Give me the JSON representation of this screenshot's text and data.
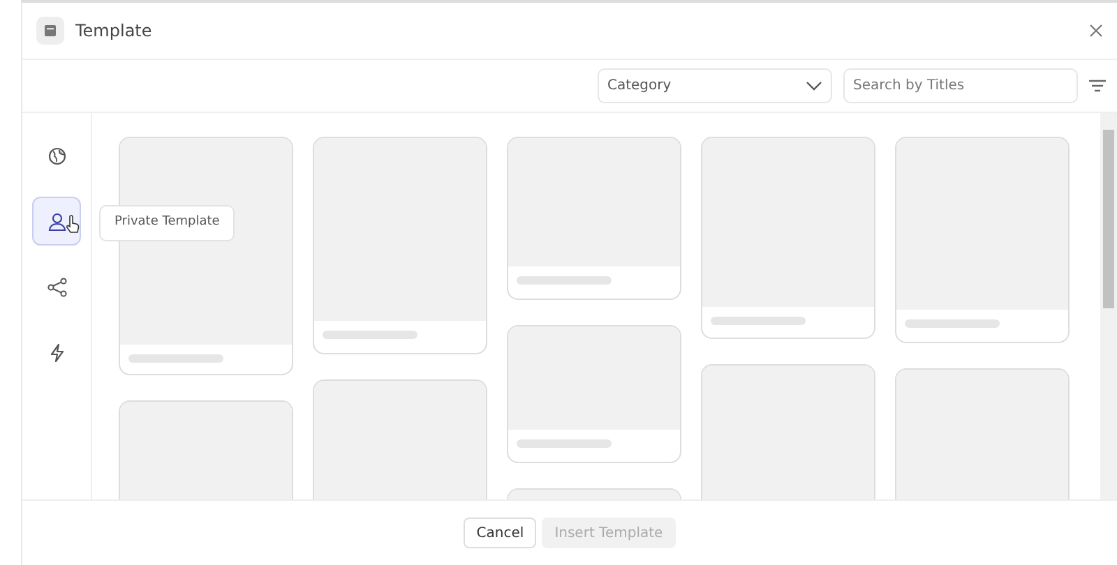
{
  "dialog": {
    "title": "Template"
  },
  "toolbar": {
    "category": {
      "value": "Category"
    },
    "search": {
      "placeholder": "Search by Titles"
    }
  },
  "sidebar": {
    "items": [
      {
        "kind": "globe",
        "selected": false
      },
      {
        "kind": "person",
        "selected": true,
        "tooltip": "Private Template"
      },
      {
        "kind": "share",
        "selected": false
      },
      {
        "kind": "bolt",
        "selected": false
      }
    ]
  },
  "buttons": [
    {
      "label": "Cancel",
      "disabled": false
    },
    {
      "label": "Insert Template",
      "disabled": true
    }
  ]
}
